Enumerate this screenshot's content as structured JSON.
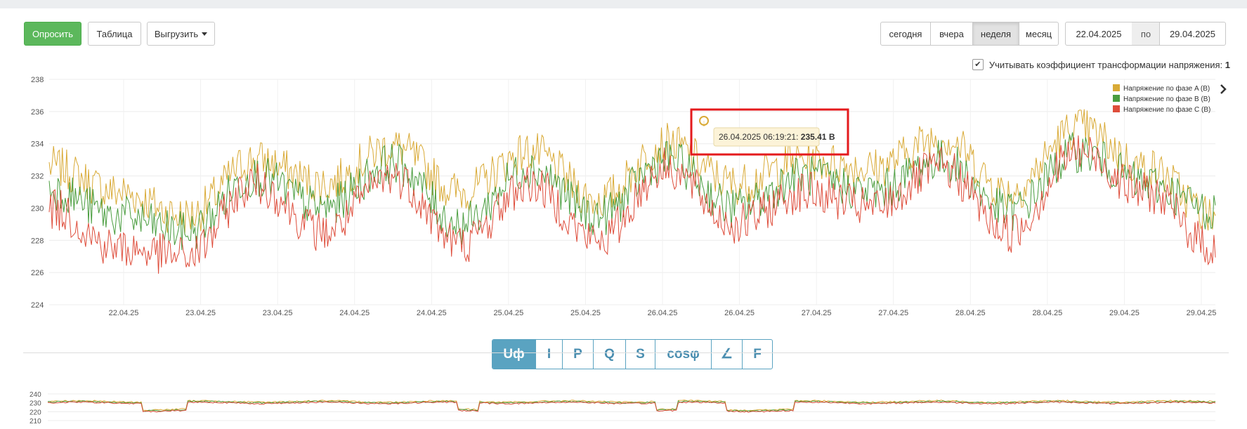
{
  "toolbar": {
    "poll_label": "Опросить",
    "table_label": "Таблица",
    "export_label": "Выгрузить"
  },
  "period": {
    "buttons": [
      "сегодня",
      "вчера",
      "неделя",
      "месяц"
    ],
    "active": "неделя",
    "date_from": "22.04.2025",
    "date_sep": "по",
    "date_to": "29.04.2025"
  },
  "option": {
    "label": "Учитывать коэффициент трансформации напряжения:",
    "value": "1",
    "checked": true
  },
  "tooltip": {
    "time": "26.04.2025 06:19:21:",
    "value": "235.41 В"
  },
  "tabs": [
    "Uф",
    "I",
    "P",
    "Q",
    "S",
    "cosφ",
    "∠",
    "F"
  ],
  "active_tab": "Uф",
  "colors": {
    "phase_a": "#d9aa36",
    "phase_b": "#4a9d3f",
    "phase_c": "#de4d3b",
    "accent": "#5aa3c1",
    "green_button": "#5cb85c",
    "highlight": "#e41a1c"
  },
  "chart_data": [
    {
      "type": "line",
      "ylim": [
        224,
        238
      ],
      "yticks": [
        224,
        226,
        228,
        230,
        232,
        234,
        236,
        238
      ],
      "xticks": [
        "22.04.25",
        "23.04.25",
        "23.04.25",
        "24.04.25",
        "24.04.25",
        "25.04.25",
        "25.04.25",
        "26.04.25",
        "26.04.25",
        "27.04.25",
        "27.04.25",
        "28.04.25",
        "28.04.25",
        "29.04.25",
        "29.04.25"
      ],
      "grid": true,
      "legend_position": "top-right",
      "x": [
        "21.04.25 12:00",
        "22.04.25 00:00",
        "22.04.25 12:00",
        "23.04.25 00:00",
        "23.04.25 12:00",
        "24.04.25 00:00",
        "24.04.25 12:00",
        "25.04.25 00:00",
        "25.04.25 12:00",
        "26.04.25 00:00",
        "26.04.25 12:00",
        "27.04.25 00:00",
        "27.04.25 12:00",
        "28.04.25 00:00",
        "28.04.25 12:00",
        "29.04.25 00:00",
        "29.04.25 06:00",
        "29.04.25 12:00"
      ],
      "series": [
        {
          "name": "Напряжение по фазе A (В)",
          "color": "#d9aa36",
          "values": [
            232.6,
            231.0,
            229.5,
            233.0,
            231.5,
            233.8,
            231.0,
            233.5,
            230.5,
            234.0,
            231.5,
            233.0,
            232.5,
            234.4,
            231.0,
            235.0,
            232.5,
            229.5
          ]
        },
        {
          "name": "Напряжение по фазе B (В)",
          "color": "#4a9d3f",
          "values": [
            231.2,
            229.5,
            228.5,
            232.0,
            230.0,
            232.8,
            229.0,
            232.5,
            229.5,
            233.0,
            230.0,
            232.0,
            231.0,
            233.0,
            229.8,
            233.5,
            231.5,
            229.8
          ]
        },
        {
          "name": "Напряжение по фазе C (В)",
          "color": "#de4d3b",
          "values": [
            230.0,
            227.5,
            227.0,
            231.5,
            228.5,
            232.0,
            227.8,
            231.5,
            228.0,
            232.5,
            229.0,
            231.0,
            230.0,
            232.5,
            228.5,
            233.5,
            231.0,
            227.5
          ]
        }
      ]
    },
    {
      "type": "line",
      "ylim": [
        210,
        240
      ],
      "yticks": [
        210,
        220,
        230,
        240
      ],
      "grid": true
    }
  ]
}
